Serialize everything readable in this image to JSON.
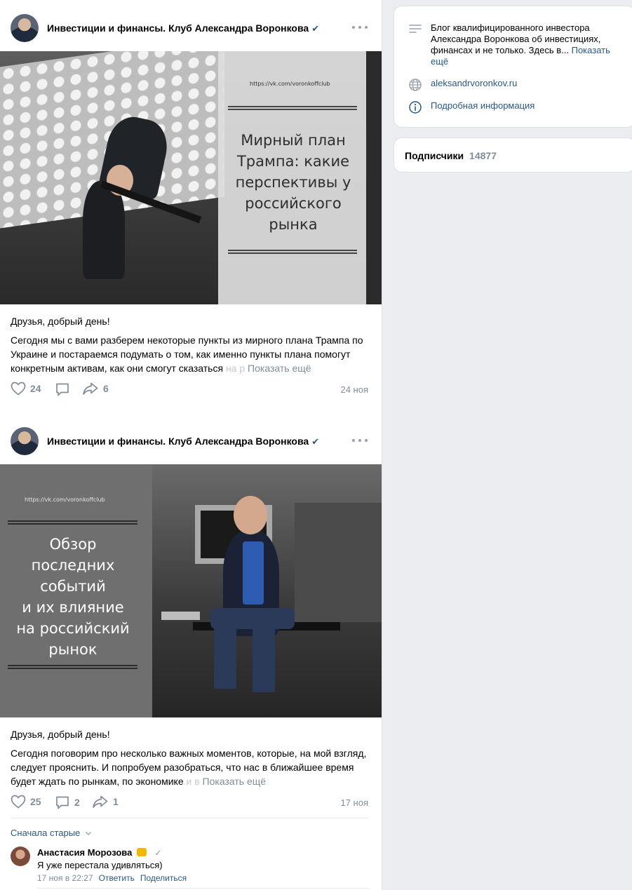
{
  "posts": [
    {
      "author": "Инвестиции и финансы. Клуб Александра Воронкова",
      "verified": "✔",
      "image": {
        "url": "https://vk.com/voronkoffclub",
        "title_lines": [
          "Мирный план",
          "Трампа: какие",
          "перспективы у",
          "российского",
          "рынка"
        ]
      },
      "greeting": "Друзья, добрый день!",
      "text": "Сегодня мы с вами разберем некоторые пункты из мирного плана Трампа по Украине и постараемся подумать о том, как именно пункты плана помогут конкретным активам, как они смогут сказаться",
      "text_fade": " на р",
      "show_more": "Показать ещё",
      "likes": "24",
      "comments": "",
      "shares": "6",
      "date": "24 ноя"
    },
    {
      "author": "Инвестиции и финансы. Клуб Александра Воронкова",
      "verified": "✔",
      "image": {
        "url": "https://vk.com/voronkoffclub",
        "title_lines": [
          "Обзор",
          "последних",
          "событий",
          "и их влияние",
          "на российский",
          "рынок"
        ]
      },
      "greeting": "Друзья, добрый день!",
      "text": "Сегодня поговорим про несколько важных моментов, которые, на мой взгляд, следует прояснить. И попробуем разобраться, что нас в ближайшее время будет ждать по рынкам, по экономике",
      "text_fade": " и в",
      "show_more": "Показать ещё",
      "likes": "25",
      "comments": "2",
      "shares": "1",
      "date": "17 ноя"
    }
  ],
  "comments": {
    "sort_label": "Сначала старые",
    "items": [
      {
        "author": "Анастасия Морозова",
        "text": "Я уже перестала удивляться)",
        "time": "17 ноя в 22:27",
        "reply": "Ответить",
        "share": "Поделиться"
      }
    ]
  },
  "sidebar": {
    "description": "Блог квалифицированного инвестора Александра Воронкова об инвестициях, финансах и не только. Здесь в...",
    "description_more": "Показать ещё",
    "website": "aleksandrvoronkov.ru",
    "details": "Подробная информация",
    "subscribers_label": "Подписчики",
    "subscribers_count": "14877"
  },
  "colors": {
    "link": "#2a5885",
    "muted": "#818c99",
    "background": "#ebedf0"
  }
}
